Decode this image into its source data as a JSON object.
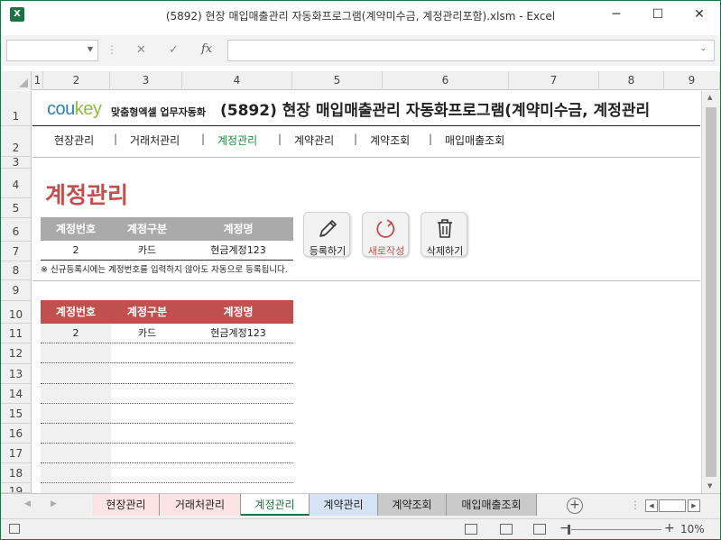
{
  "window": {
    "app_icon": "X",
    "title": "(5892) 현장 매입매출관리 자동화프로그램(계약미수금, 계정관리포함).xlsm - Excel",
    "minimize": "─",
    "restore": "☐",
    "close": "✕"
  },
  "formula_bar": {
    "cancel": "✕",
    "confirm": "✓",
    "fx": "fx",
    "separator": "⋮"
  },
  "columns": [
    "1",
    "2",
    "3",
    "4",
    "5",
    "6",
    "7",
    "8",
    "9"
  ],
  "rows": [
    "1",
    "2",
    "3",
    "4",
    "5",
    "6",
    "7",
    "8",
    "9",
    "10",
    "11",
    "12",
    "13",
    "14",
    "15",
    "16",
    "17",
    "18",
    "19"
  ],
  "header": {
    "logo_cou": "cou",
    "logo_key": "key",
    "logo_tagline": "맞춤형엑셀 업무자동화",
    "title": "(5892) 현장 매입매출관리 자동화프로그램(계약미수금, 계정관리"
  },
  "nav": {
    "items": [
      "현장관리",
      "거래처관리",
      "계정관리",
      "계약관리",
      "계약조회",
      "매입매출조회"
    ],
    "separator": "|",
    "active": "계정관리"
  },
  "section": {
    "title": "계정관리"
  },
  "input_table": {
    "headers": [
      "계정번호",
      "계정구분",
      "계정명"
    ],
    "row": [
      "2",
      "카드",
      "현금계정123"
    ]
  },
  "note": "※ 신규등록시에는 계정번호를 입력하지 않아도 자동으로 등록됩니다.",
  "buttons": {
    "register": "등록하기",
    "new": "새로작성",
    "delete": "삭제하기"
  },
  "list_table": {
    "headers": [
      "계정번호",
      "계정구분",
      "계정명"
    ],
    "rows": [
      [
        "2",
        "카드",
        "현금계정123"
      ]
    ]
  },
  "sheet_tabs": {
    "tabs": [
      "현장관리",
      "거래처관리",
      "계정관리",
      "계약관리",
      "계약조회",
      "매입매출조회"
    ],
    "active": "계정관리",
    "colors": [
      "#fbe3e3",
      "#fbe3e3",
      "#ffffff",
      "#d6e3f5",
      "#c9c9c9",
      "#c9c9c9"
    ]
  },
  "status": {
    "zoom": "10%",
    "zoom_minus": "−",
    "zoom_plus": "+"
  },
  "colors": {
    "accent_green": "#1e7145",
    "nav_active": "#1e8a3c",
    "section_red": "#c0504d",
    "header_gray": "#aaaaaa"
  }
}
